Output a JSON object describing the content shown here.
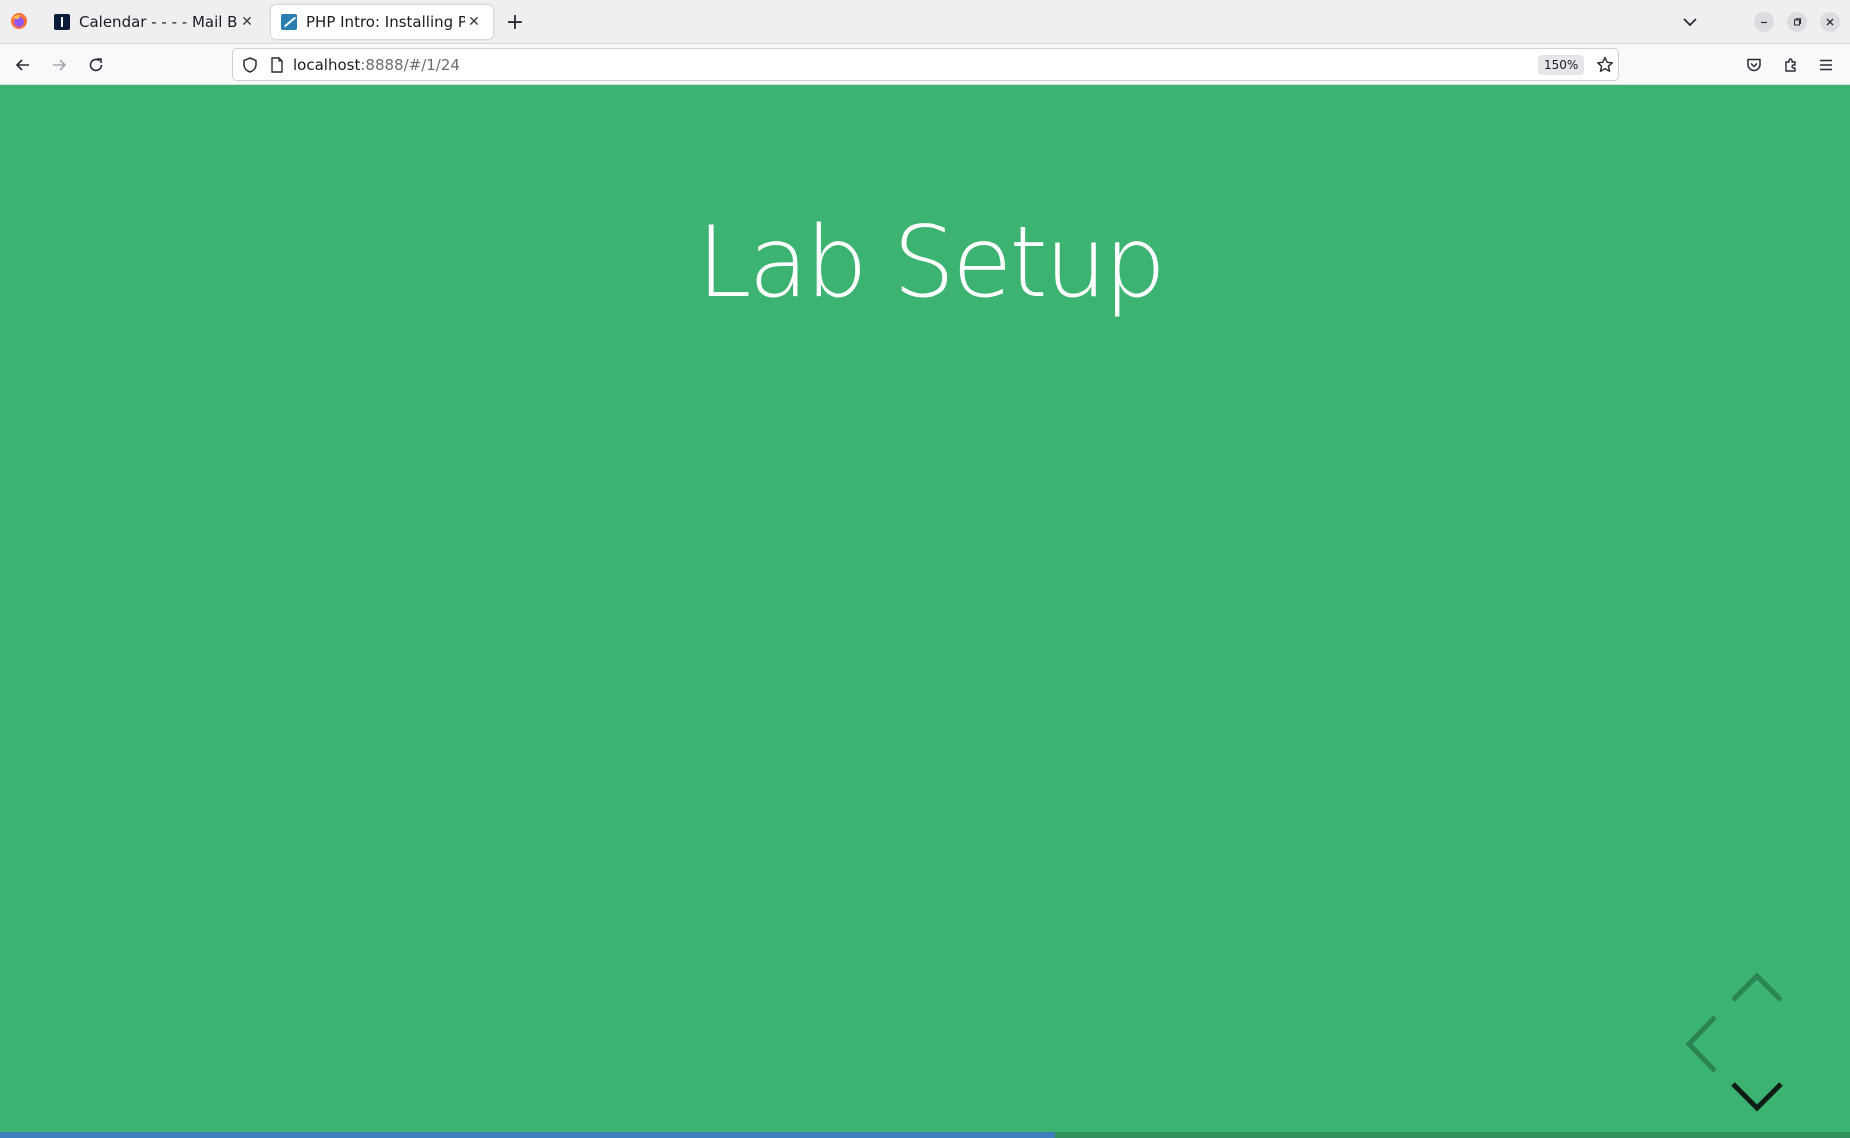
{
  "browser": {
    "tabs": [
      {
        "label": "Calendar - - - - Mail Basic",
        "active": false,
        "favicon": "calendar-favicon"
      },
      {
        "label": "PHP Intro: Installing PHP",
        "active": true,
        "favicon": "php-favicon"
      }
    ],
    "new_tab_symbol": "+",
    "close_symbol": "✕",
    "url": {
      "host": "localhost",
      "rest": ":8888/#/1/24"
    },
    "zoom": "150%"
  },
  "slide": {
    "title": "Lab Setup",
    "background_color": "#3cb371",
    "progress_fraction": 0.57
  },
  "controls": {
    "up": {
      "icon": "chevron-up-icon",
      "enabled": true
    },
    "left": {
      "icon": "chevron-left-icon",
      "enabled": true
    },
    "down": {
      "icon": "chevron-down-icon",
      "enabled": true,
      "highlighted": true
    }
  }
}
